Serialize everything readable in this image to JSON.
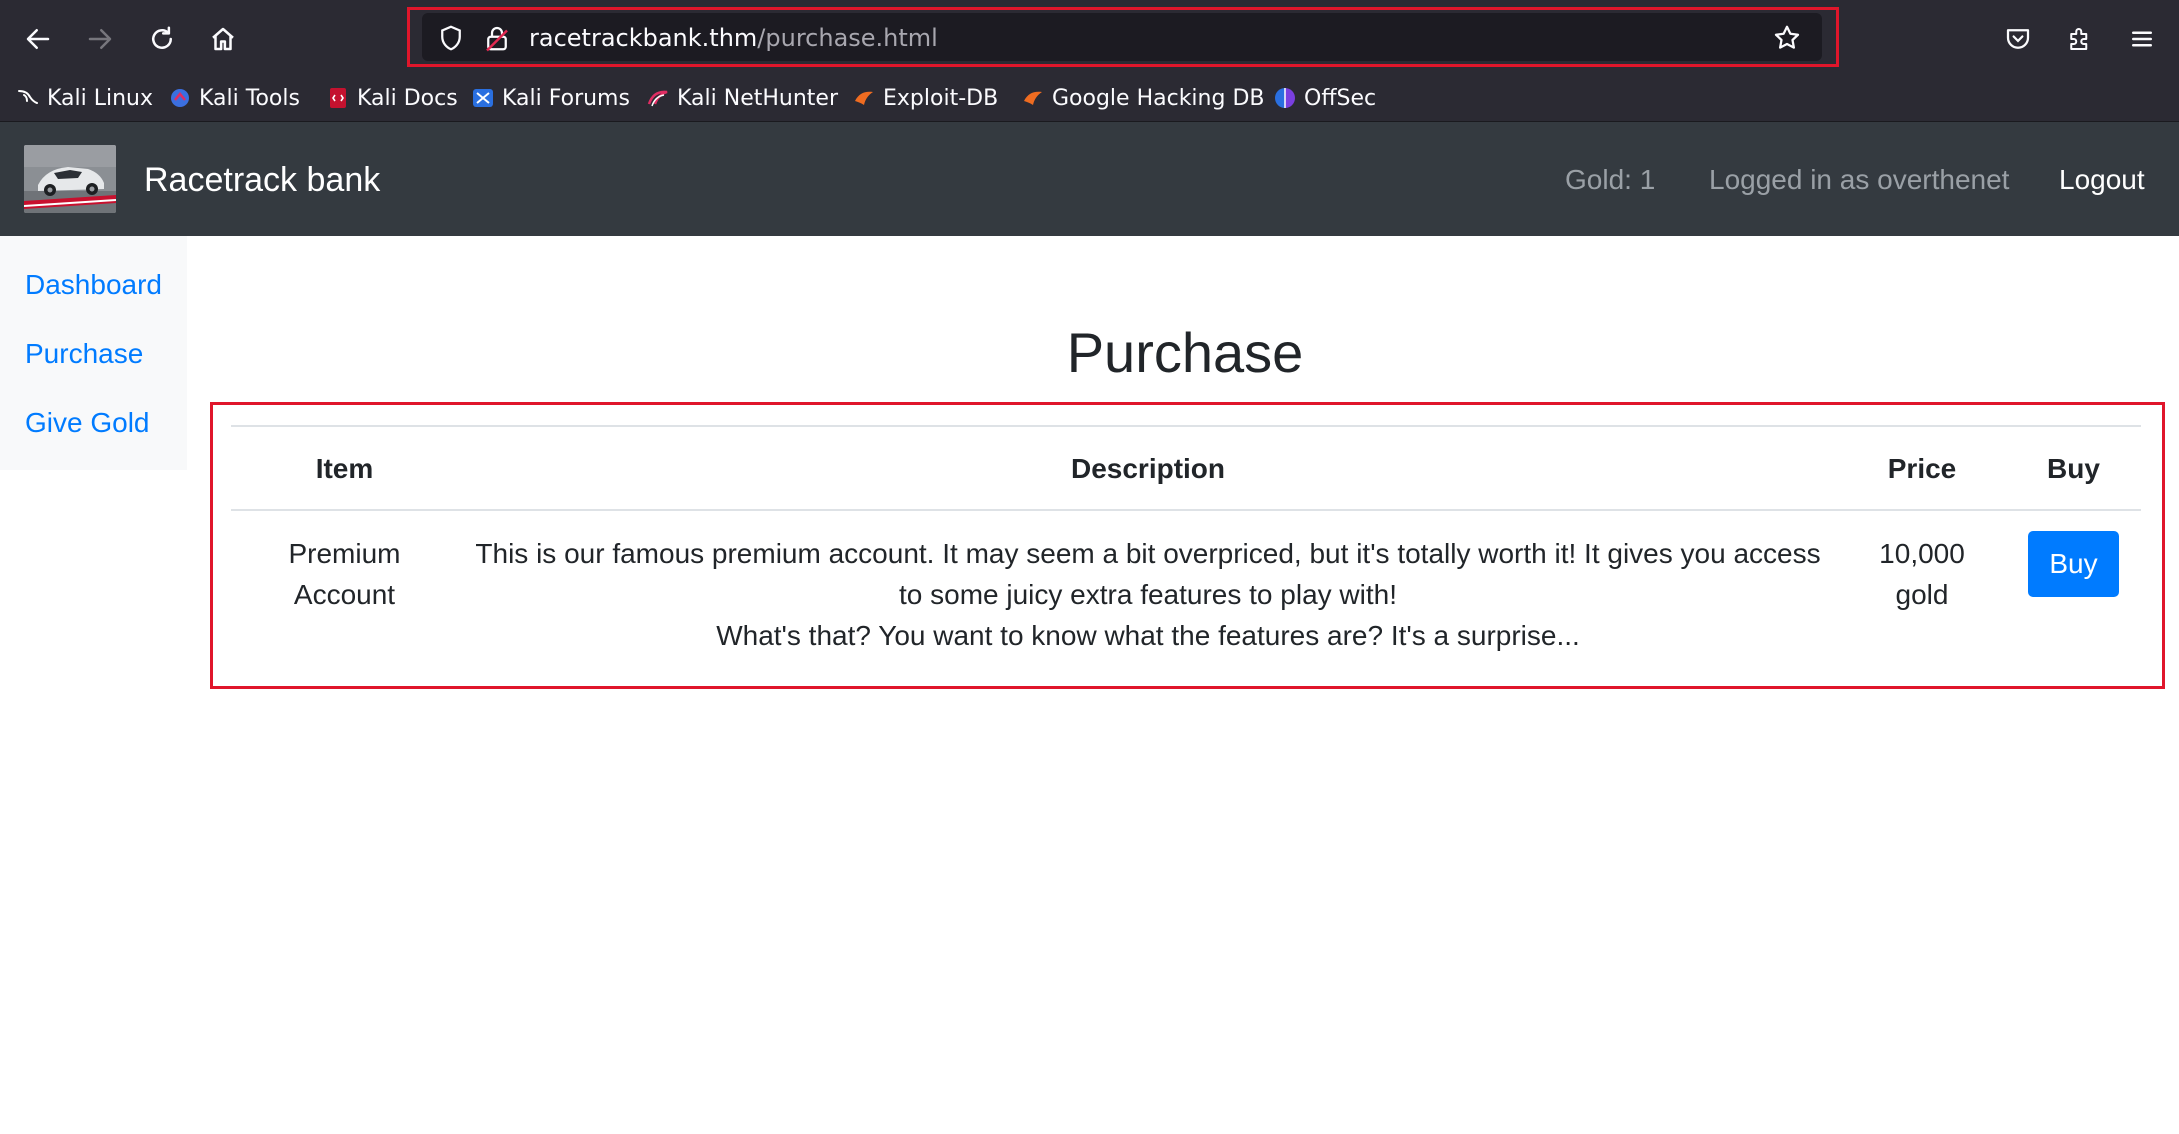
{
  "browser": {
    "url_host": "racetrackbank.thm",
    "url_path": "/purchase.html",
    "bookmarks": [
      {
        "label": "Kali Linux",
        "icon": "kali-dragon-icon"
      },
      {
        "label": "Kali Tools",
        "icon": "kali-tools-icon"
      },
      {
        "label": "Kali Docs",
        "icon": "kali-docs-icon"
      },
      {
        "label": "Kali Forums",
        "icon": "kali-forums-icon"
      },
      {
        "label": "Kali NetHunter",
        "icon": "kali-nethunter-icon"
      },
      {
        "label": "Exploit-DB",
        "icon": "exploit-db-icon"
      },
      {
        "label": "Google Hacking DB",
        "icon": "google-hacking-db-icon"
      },
      {
        "label": "OffSec",
        "icon": "offsec-icon"
      }
    ]
  },
  "navbar": {
    "brand": "Racetrack bank",
    "gold": "Gold: 1",
    "user": "Logged in as overthenet",
    "logout": "Logout"
  },
  "sidebar": {
    "items": [
      {
        "label": "Dashboard"
      },
      {
        "label": "Purchase"
      },
      {
        "label": "Give Gold"
      }
    ]
  },
  "main": {
    "title": "Purchase",
    "table": {
      "headers": [
        "Item",
        "Description",
        "Price",
        "Buy"
      ],
      "rows": [
        {
          "item_line1": "Premium",
          "item_line2": "Account",
          "desc_line1": "This is our famous premium account. It may seem a bit overpriced, but it's totally worth it! It gives you access",
          "desc_line2": "to some juicy extra features to play with!",
          "desc_line3": "What's that? You want to know what the features are? It's a surprise...",
          "price_line1": "10,000",
          "price_line2": "gold",
          "buy_label": "Buy"
        }
      ]
    }
  },
  "colors": {
    "accent_blue": "#007bff",
    "navbar_bg": "#343a40",
    "highlight_red": "#e0162b"
  }
}
